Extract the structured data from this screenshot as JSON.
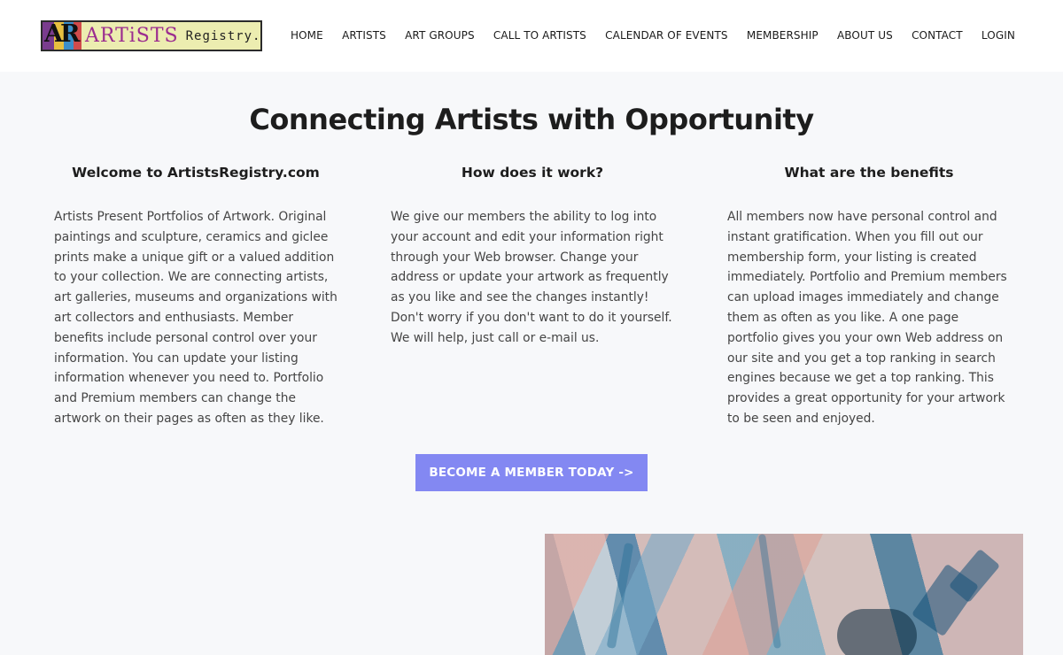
{
  "logo": {
    "mark": "AR",
    "artists_text": "ARTiSTS",
    "registry_text": "Registry.com"
  },
  "nav": {
    "items": [
      "HOME",
      "ARTISTS",
      "ART GROUPS",
      "CALL TO ARTISTS",
      "CALENDAR OF EVENTS",
      "MEMBERSHIP",
      "ABOUT US",
      "CONTACT",
      "LOGIN"
    ]
  },
  "hero": {
    "title": "Connecting Artists with Opportunity"
  },
  "columns": [
    {
      "heading": "Welcome to ArtistsRegistry.com",
      "body": "Artists Present Portfolios of Artwork. Original paintings and sculpture, ceramics and giclee prints make a unique gift or a valued addition to your collection. We are connecting artists, art galleries, museums and organizations with art collectors and enthusiasts. Member benefits include personal control over your information. You can update your listing information whenever you need to. Portfolio and Premium members can change the artwork on their pages as often as they like."
    },
    {
      "heading": "How does it work?",
      "body": "We give our members the ability to log into your account and edit your information right through your Web browser. Change your address or update your artwork as frequently as you like and see the changes instantly! Don't worry if you don't want to do it yourself. We will help, just call or e-mail us."
    },
    {
      "heading": "What are the benefits",
      "body": "All members now have personal control and instant gratification. When you fill out our membership form, your listing is created immediately. Portfolio and Premium members can upload images immediately and change them as often as you like. A one page portfolio gives you your own Web address on our site and you get a top ranking in search engines because we get a top ranking. This provides a great opportunity for your artwork to be seen and enjoyed."
    }
  ],
  "cta": {
    "label": "BECOME A MEMBER TODAY ->"
  },
  "colors": {
    "cta_background": "#8388f2",
    "page_background": "#f7f8fa",
    "header_background": "#ffffff",
    "logo_background": "#ecedb0"
  }
}
